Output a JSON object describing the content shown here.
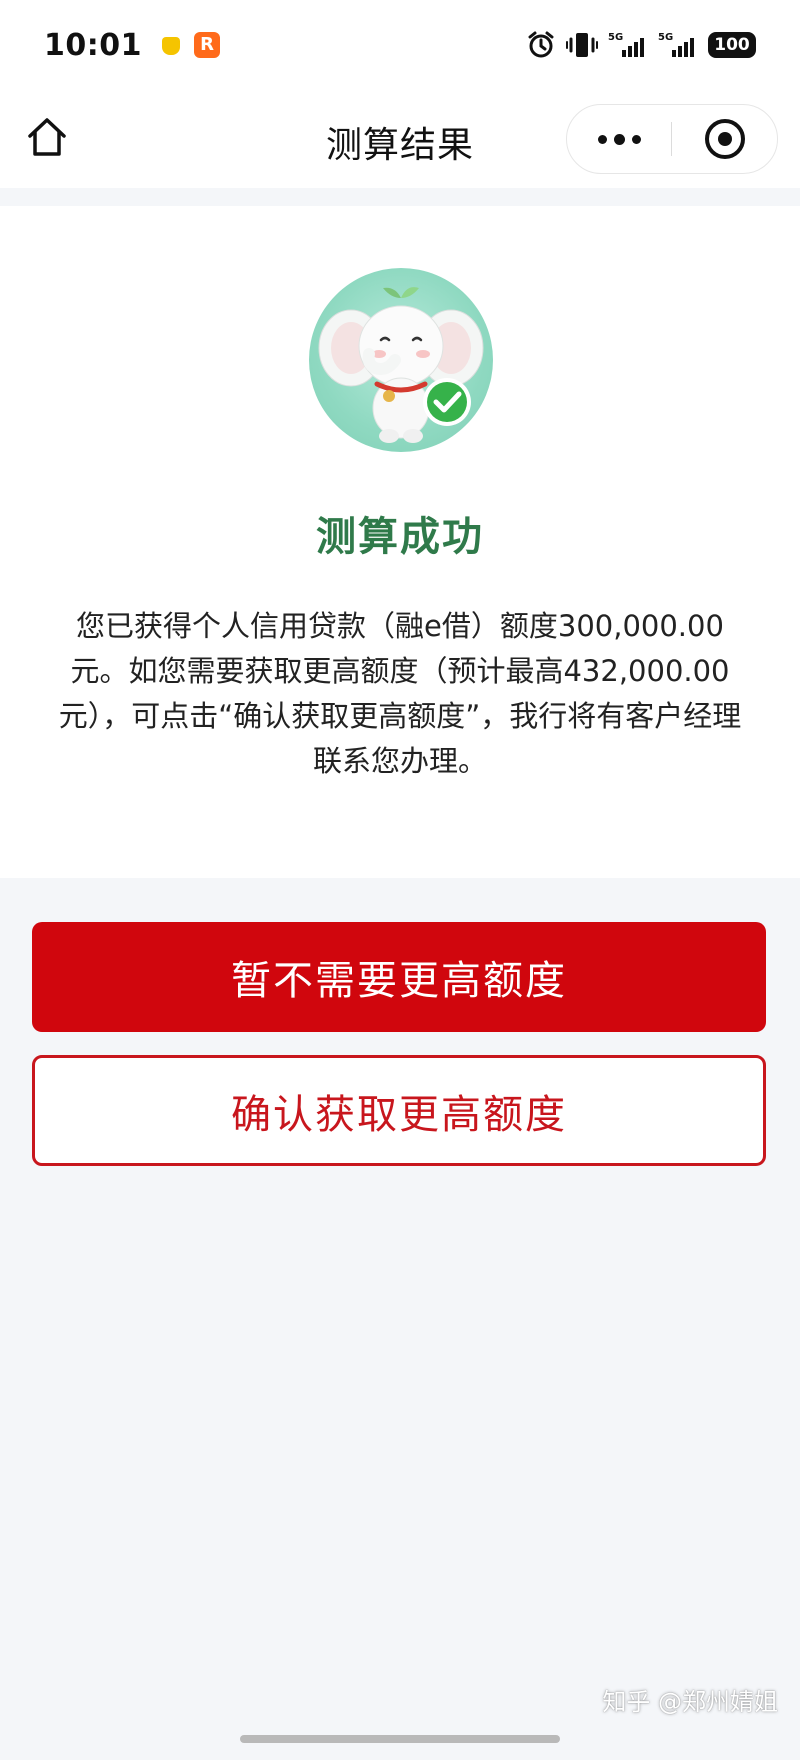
{
  "status_bar": {
    "time": "10:01",
    "battery": "100",
    "icons": [
      "app-notification-icon",
      "app-r-icon",
      "alarm-icon",
      "vibrate-icon",
      "signal-5g-icon",
      "signal-5g-icon"
    ]
  },
  "nav": {
    "title": "测算结果",
    "home_icon": "home-icon",
    "more_icon": "more-dots-icon",
    "close_icon": "close-capsule-icon"
  },
  "result": {
    "mascot_icon": "elephant-mascot-check-icon",
    "title": "测算成功",
    "description": "您已获得个人信用贷款（融e借）额度300,000.00元。如您需要获取更高额度（预计最高432,000.00元），可点击“确认获取更高额度”，我行将有客户经理联系您办理。"
  },
  "actions": {
    "decline_label": "暂不需要更高额度",
    "confirm_label": "确认获取更高额度"
  },
  "watermark": "知乎 @郑州婧姐",
  "colors": {
    "accent_red": "#d0060d",
    "success_green": "#2f7a4a",
    "background": "#f4f6f9"
  }
}
